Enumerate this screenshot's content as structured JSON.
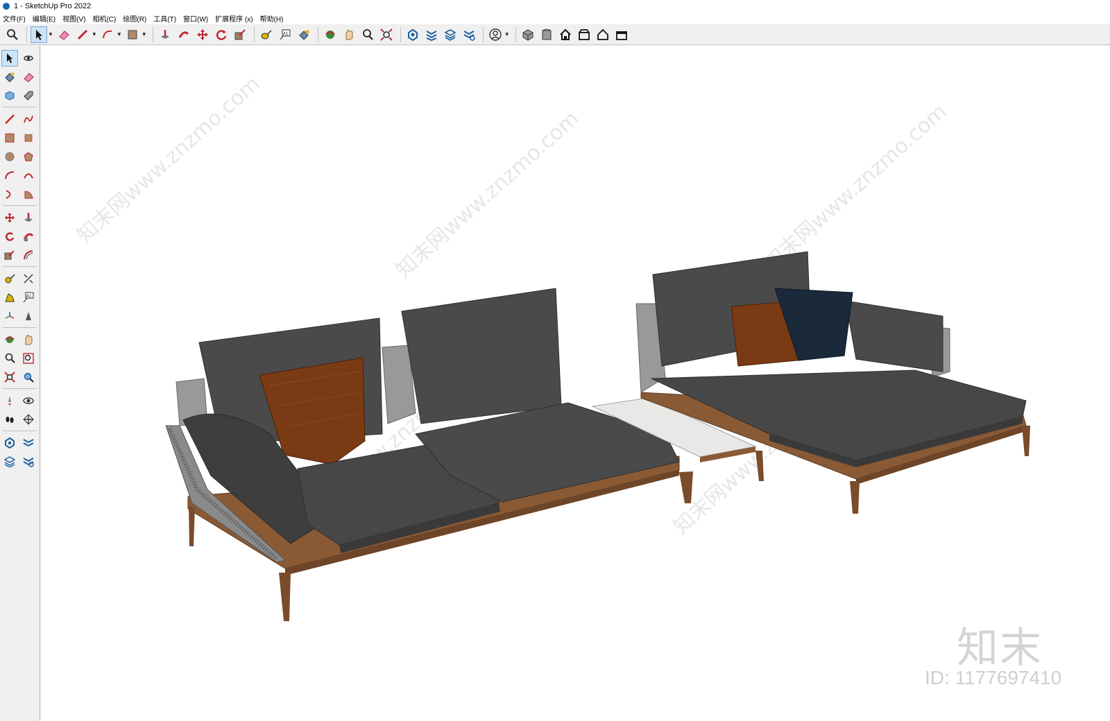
{
  "window": {
    "title": "1 - SketchUp Pro 2022"
  },
  "menubar": {
    "items": [
      "文件(F)",
      "编辑(E)",
      "视图(V)",
      "相机(C)",
      "绘图(R)",
      "工具(T)",
      "窗口(W)",
      "扩展程序 (x)",
      "帮助(H)"
    ]
  },
  "toolbar_top": {
    "icons": [
      "zoom-icon",
      "select-icon",
      "eraser-icon",
      "pencil-icon",
      "arc-icon",
      "rectangle-icon",
      "push-pull-icon",
      "follow-me-icon",
      "move-icon",
      "rotate-icon",
      "scale-icon",
      "tape-measure-icon",
      "text-icon",
      "paint-bucket-icon",
      "orbit-icon",
      "pan-icon",
      "zoom-window-icon",
      "zoom-extents-icon",
      "warehouse-icon",
      "extension-warehouse-icon",
      "layout-icon",
      "solid-tools-icon",
      "account-icon",
      "iso-view-icon",
      "front-view-icon",
      "home-icon",
      "top-view-icon",
      "house-icon",
      "right-view-icon"
    ]
  },
  "toolbar_left": {
    "icons": [
      "select-icon",
      "orbit-icon",
      "paint-bucket-icon",
      "eraser-icon",
      "component-icon",
      "tag-icon",
      "line-icon",
      "freehand-icon",
      "rectangle-icon",
      "rotated-rectangle-icon",
      "circle-icon",
      "polygon-icon",
      "arc-icon",
      "two-point-arc-icon",
      "three-point-arc-icon",
      "pie-icon",
      "move-icon",
      "push-pull-icon",
      "rotate-icon",
      "follow-me-icon",
      "scale-icon",
      "offset-icon",
      "tape-measure-icon",
      "dimension-icon",
      "protractor-icon",
      "text-icon",
      "axes-icon",
      "3d-text-icon",
      "orbit-tool-icon",
      "pan-icon",
      "zoom-icon",
      "zoom-window-icon",
      "zoom-extents-icon",
      "previous-view-icon",
      "position-camera-icon",
      "look-around-icon",
      "walk-icon",
      "section-plane-icon",
      "warehouse-icon",
      "extension-icon",
      "layout-icon",
      "solid-tools-icon"
    ]
  },
  "watermark": {
    "logo": "知末",
    "id": "ID: 1177697410",
    "diagonal": "知末网www.znzmo.com"
  },
  "colors": {
    "cushion": "#4a4a4a",
    "cushion_dark": "#3a3a3a",
    "wood": "#8a5a35",
    "marble": "#e8e8e6",
    "pillow_orange": "#7a3a14",
    "pillow_navy": "#1a2a3a"
  }
}
